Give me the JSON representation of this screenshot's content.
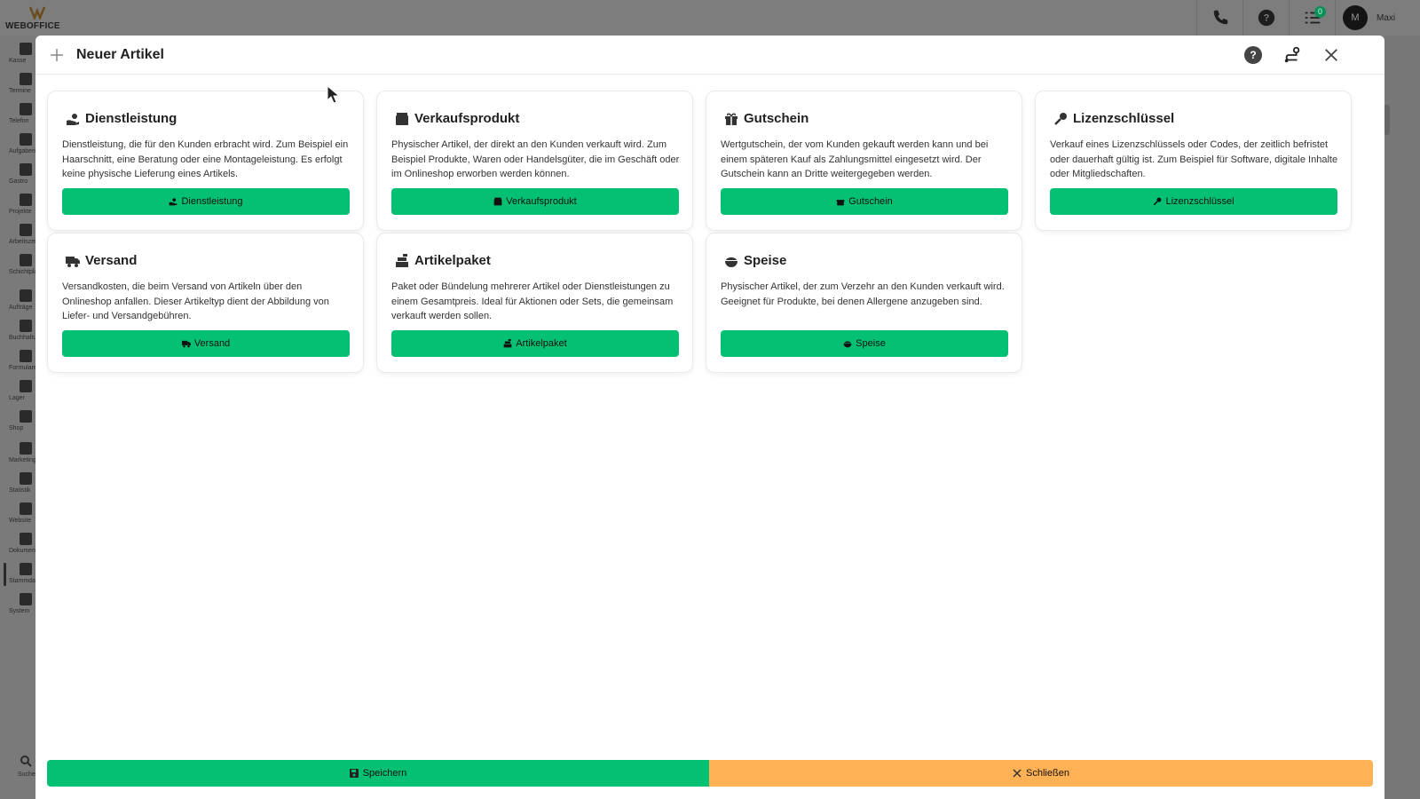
{
  "app": {
    "brand": "WEBOFFICE",
    "user_initial": "M",
    "user_name": "Maxi",
    "tasks_badge": "0"
  },
  "sidebar": {
    "items": [
      {
        "label": "Kasse"
      },
      {
        "label": "Termine"
      },
      {
        "label": "Telefon"
      },
      {
        "label": "Aufgaben"
      },
      {
        "label": "Gastro"
      },
      {
        "label": "Projekte"
      },
      {
        "label": "Arbeitszeit"
      },
      {
        "label": "Schichtplanung"
      },
      {
        "label": "Aufträge"
      },
      {
        "label": "Buchhaltung"
      },
      {
        "label": "Formulare"
      },
      {
        "label": "Lager"
      },
      {
        "label": "Shop"
      },
      {
        "label": "Marketing"
      },
      {
        "label": "Statistik"
      },
      {
        "label": "Website"
      },
      {
        "label": "Dokumente"
      },
      {
        "label": "Stammdaten"
      },
      {
        "label": "System"
      }
    ],
    "search_label": "Suche"
  },
  "modal": {
    "title": "Neuer Artikel",
    "cards": [
      {
        "icon": "hand-coins-icon",
        "title": "Dienstleistung",
        "description": "Dienstleistung, die für den Kunden erbracht wird. Zum Beispiel ein Haarschnitt, eine Beratung oder eine Montageleistung. Es erfolgt keine physische Lieferung eines Artikels.",
        "button": "Dienstleistung"
      },
      {
        "icon": "box-icon",
        "title": "Verkaufsprodukt",
        "description": "Physischer Artikel, der direkt an den Kunden verkauft wird. Zum Beispiel Produkte, Waren oder Handelsgüter, die im Geschäft oder im Onlineshop erworben werden können.",
        "button": "Verkaufsprodukt"
      },
      {
        "icon": "gift-icon",
        "title": "Gutschein",
        "description": "Wertgutschein, der vom Kunden gekauft werden kann und bei einem späteren Kauf als Zahlungsmittel eingesetzt wird. Der Gutschein kann an Dritte weitergegeben werden.",
        "button": "Gutschein"
      },
      {
        "icon": "key-icon",
        "title": "Lizenzschlüssel",
        "description": "Verkauf eines Lizenzschlüssels oder Codes, der zeitlich befristet oder dauerhaft gültig ist. Zum Beispiel für Software, digitale Inhalte oder Mitgliedschaften.",
        "button": "Lizenzschlüssel"
      },
      {
        "icon": "truck-icon",
        "title": "Versand",
        "description": "Versandkosten, die beim Versand von Artikeln über den Onlineshop anfallen. Dieser Artikeltyp dient der Abbildung von Liefer- und Versandgebühren.",
        "button": "Versand"
      },
      {
        "icon": "boxes-stacked-icon",
        "title": "Artikelpaket",
        "description": "Paket oder Bündelung mehrerer Artikel oder Dienstleistungen zu einem Gesamtpreis. Ideal für Aktionen oder Sets, die gemeinsam verkauft werden sollen.",
        "button": "Artikelpaket"
      },
      {
        "icon": "bowl-food-icon",
        "title": "Speise",
        "description": "Physischer Artikel, der zum Verzehr an den Kunden verkauft wird. Geeignet für Produkte, bei denen Allergene anzugeben sind.",
        "button": "Speise"
      }
    ],
    "footer": {
      "save_label": "Speichern",
      "close_label": "Schließen"
    }
  }
}
